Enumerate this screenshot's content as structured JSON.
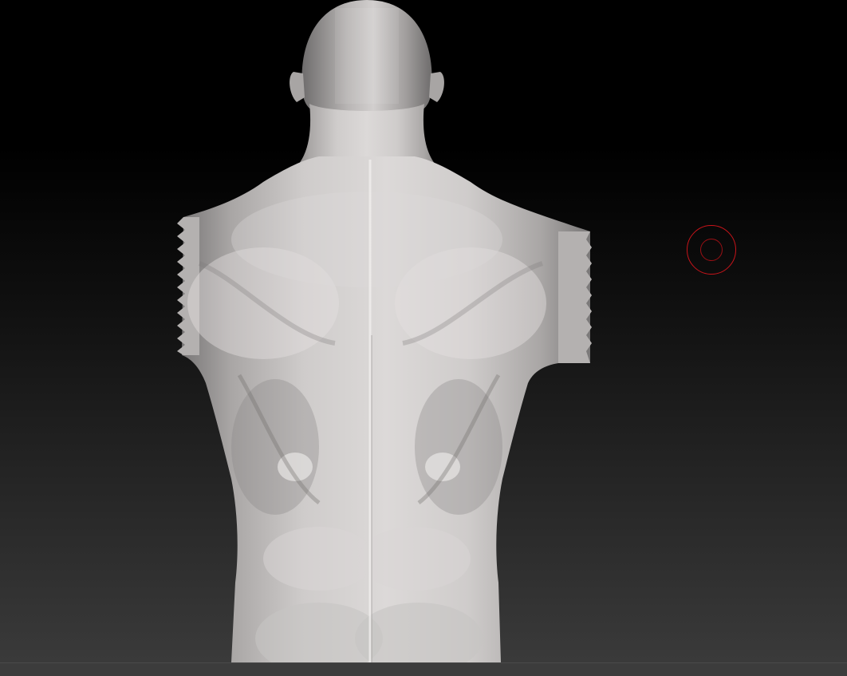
{
  "canvas": {
    "background_top": "#000000",
    "background_bottom": "#3a3a3a"
  },
  "model": {
    "view": "back",
    "material_color": "#c9c6c4"
  },
  "brush_cursor": {
    "color": "#c8141a"
  },
  "status_bar": {
    "color": "#3c3c3c"
  }
}
